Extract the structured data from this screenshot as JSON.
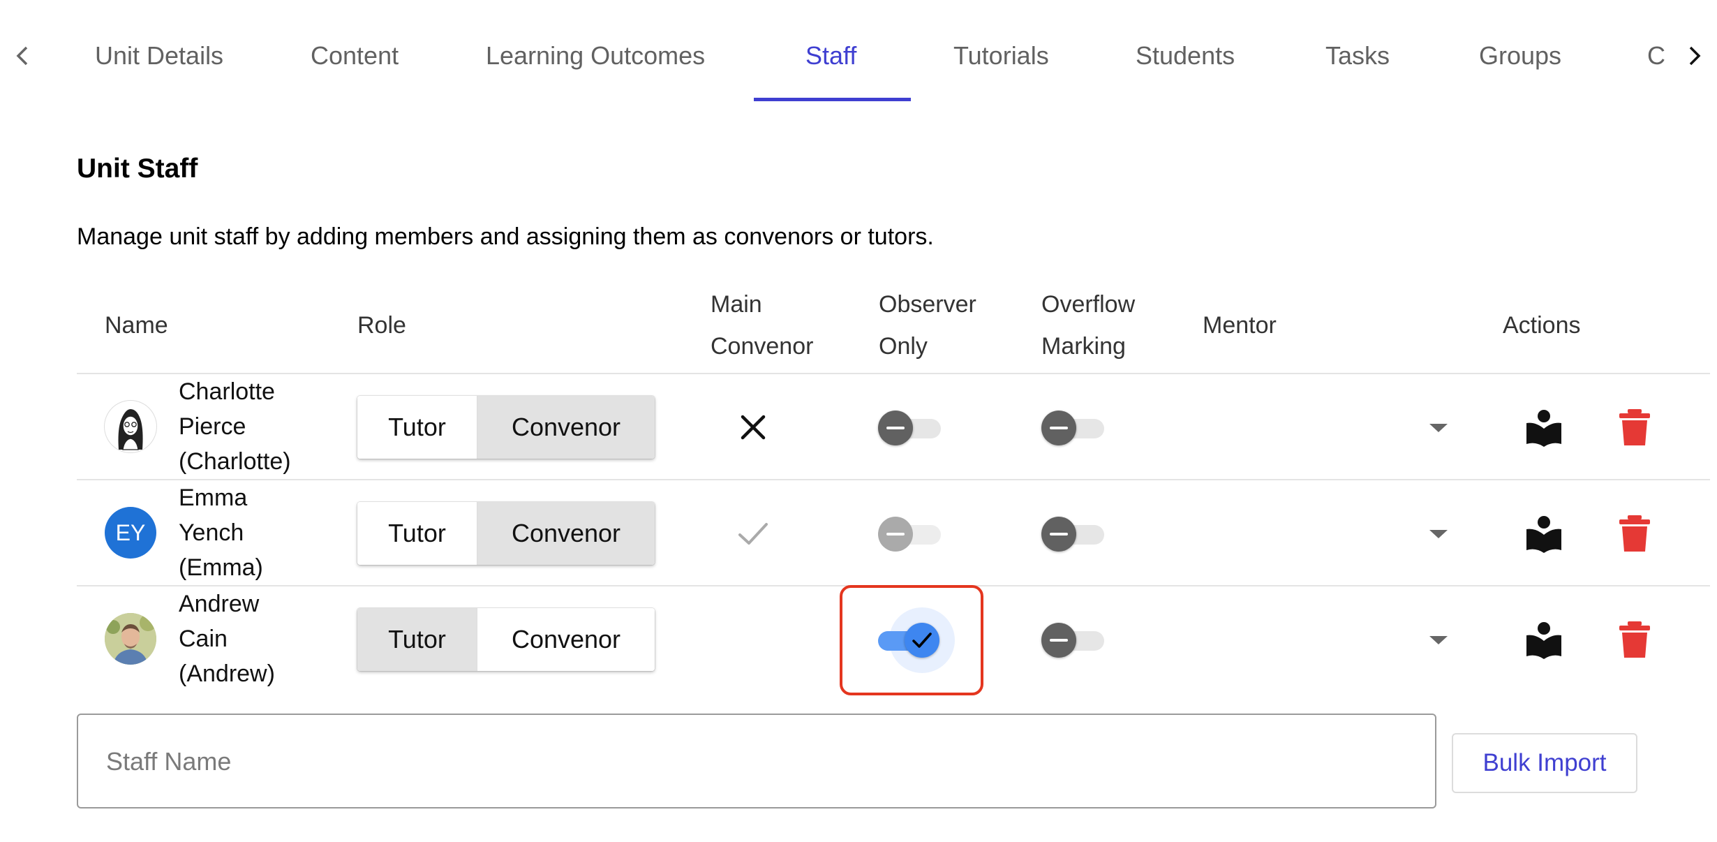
{
  "tabs": [
    {
      "label": "Unit Details",
      "active": false
    },
    {
      "label": "Content",
      "active": false
    },
    {
      "label": "Learning Outcomes",
      "active": false
    },
    {
      "label": "Staff",
      "active": true
    },
    {
      "label": "Tutorials",
      "active": false
    },
    {
      "label": "Students",
      "active": false
    },
    {
      "label": "Tasks",
      "active": false
    },
    {
      "label": "Groups",
      "active": false
    },
    {
      "label": "C",
      "active": false
    }
  ],
  "section": {
    "title": "Unit Staff",
    "description": "Manage unit staff by adding members and assigning them as convenors or tutors."
  },
  "table": {
    "headers": {
      "name": "Name",
      "role": "Role",
      "main_convenor_1": "Main",
      "main_convenor_2": "Convenor",
      "observer_1": "Observer",
      "observer_2": "Only",
      "overflow_1": "Overflow",
      "overflow_2": "Marking",
      "mentor": "Mentor",
      "actions": "Actions"
    },
    "role_labels": {
      "tutor": "Tutor",
      "convenor": "Convenor"
    },
    "rows": [
      {
        "name_line1": "Charlotte",
        "name_line2": "Pierce",
        "name_line3": "(Charlotte)",
        "avatar": "sketch-portrait",
        "role": "Convenor",
        "main_convenor": "cross-icon",
        "observer_only": false,
        "overflow_marking": false
      },
      {
        "name_line1": "Emma",
        "name_line2": "Yench",
        "name_line3": "(Emma)",
        "avatar_initials": "EY",
        "avatar_color": "#1f72d6",
        "role": "Convenor",
        "main_convenor": "check-icon",
        "observer_only": false,
        "observer_disabled": true,
        "overflow_marking": false
      },
      {
        "name_line1": "Andrew",
        "name_line2": "Cain",
        "name_line3": "(Andrew)",
        "avatar": "photo-portrait",
        "role": "Tutor",
        "main_convenor": "none",
        "observer_only": true,
        "overflow_marking": false
      }
    ]
  },
  "add_staff": {
    "placeholder": "Staff Name",
    "value": ""
  },
  "bulk_import_label": "Bulk Import",
  "colors": {
    "accent": "#3f3fd1",
    "delete": "#e53935",
    "highlight": "#e4361f",
    "toggle_on": "#3e86f0"
  }
}
